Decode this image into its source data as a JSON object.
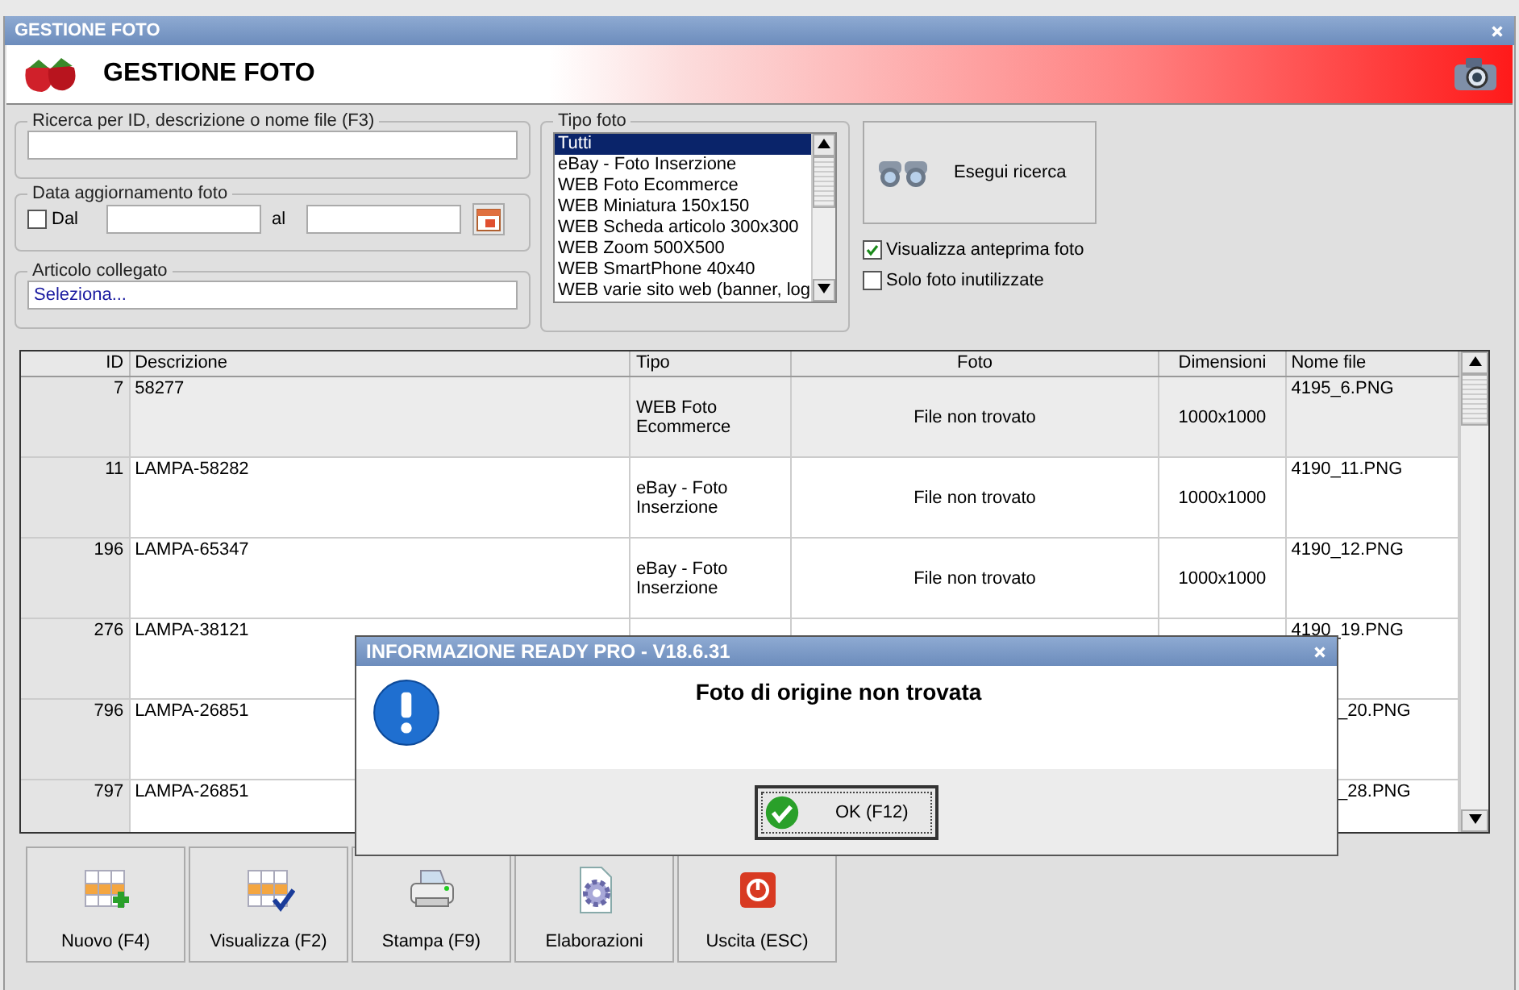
{
  "window": {
    "title": "GESTIONE FOTO"
  },
  "header": {
    "title": "GESTIONE FOTO"
  },
  "search": {
    "label": "Ricerca per ID, descrizione o nome file (F3)"
  },
  "date_filter": {
    "label": "Data aggiornamento foto",
    "from_label": "Dal",
    "from_checked": false,
    "to_label": "al"
  },
  "linked_item": {
    "label": "Articolo collegato",
    "placeholder": "Seleziona..."
  },
  "photo_type": {
    "label": "Tipo foto",
    "options": [
      {
        "text": "Tutti",
        "selected": true
      },
      {
        "text": "eBay - Foto Inserzione",
        "selected": false
      },
      {
        "text": "WEB Foto Ecommerce",
        "selected": false
      },
      {
        "text": "WEB Miniatura 150x150",
        "selected": false
      },
      {
        "text": "WEB Scheda articolo 300x300",
        "selected": false
      },
      {
        "text": "WEB Zoom 500X500",
        "selected": false
      },
      {
        "text": "WEB SmartPhone 40x40",
        "selected": false
      },
      {
        "text": "WEB varie sito web (banner, log",
        "selected": false
      }
    ]
  },
  "search_button": "Esegui ricerca",
  "options": [
    {
      "label": "Visualizza anteprima foto",
      "checked": true
    },
    {
      "label": "Solo foto inutilizzate",
      "checked": false
    }
  ],
  "table": {
    "columns": [
      "ID",
      "Descrizione",
      "Tipo",
      "Foto",
      "Dimensioni",
      "Nome file"
    ],
    "rows": [
      {
        "selected": true,
        "cut_left": false,
        "cells": [
          "7",
          "58277",
          "WEB Foto Ecommerce",
          "File non trovato",
          "1000x1000",
          "4195_6.PNG"
        ]
      },
      {
        "selected": false,
        "cut_left": false,
        "cells": [
          "11",
          "LAMPA-58282",
          "eBay - Foto Inserzione",
          "File non trovato",
          "1000x1000",
          "4190_11.PNG"
        ]
      },
      {
        "selected": false,
        "cut_left": false,
        "cells": [
          "196",
          "LAMPA-65347",
          "eBay - Foto Inserzione",
          "File non trovato",
          "1000x1000",
          "4190_12.PNG"
        ]
      },
      {
        "selected": false,
        "cut_left": false,
        "cells": [
          "276",
          "LAMPA-38121",
          null,
          null,
          null,
          "4190_19.PNG"
        ]
      },
      {
        "selected": false,
        "cut_left": true,
        "cells": [
          "796",
          "LAMPA-26851",
          null,
          null,
          null,
          "_20.PNG"
        ]
      },
      {
        "selected": false,
        "cut_left": true,
        "cells": [
          "797",
          "LAMPA-26851",
          null,
          null,
          null,
          "_28.PNG"
        ]
      }
    ]
  },
  "toolbar": [
    {
      "kind": "new",
      "label": "Nuovo (F4)"
    },
    {
      "kind": "view",
      "label": "Visualizza (F2)"
    },
    {
      "kind": "print",
      "label": "Stampa (F9)"
    },
    {
      "kind": "process",
      "label": "Elaborazioni"
    },
    {
      "kind": "exit",
      "label": "Uscita (ESC)"
    }
  ],
  "dialog": {
    "title": "INFORMAZIONE READY PRO - V18.6.31",
    "message": "Foto di origine non trovata",
    "button": "OK (F12)"
  }
}
